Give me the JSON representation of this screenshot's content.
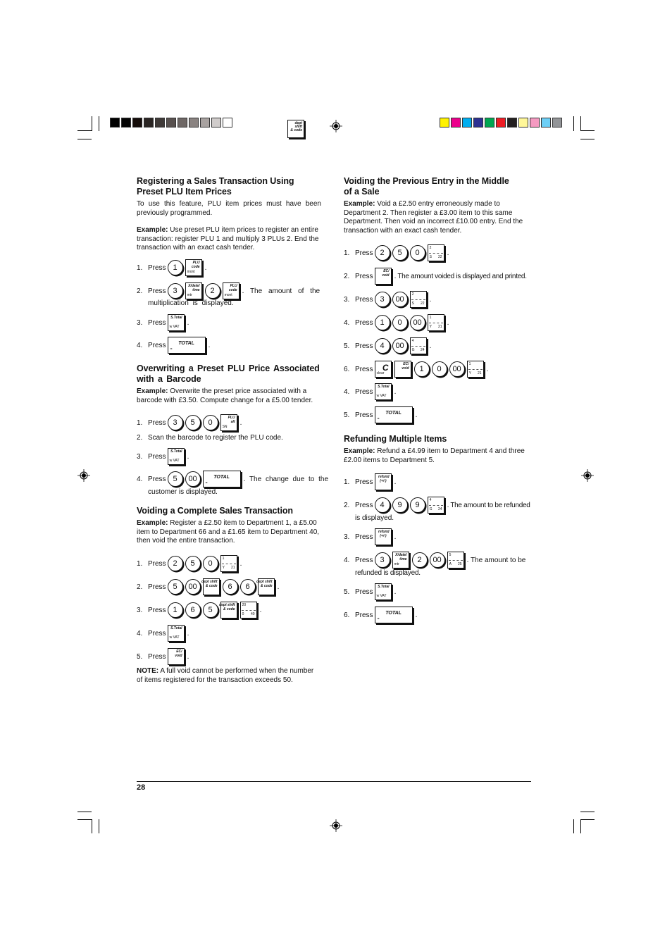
{
  "print_marks": {
    "gray_swatches": [
      "#000000",
      "#050505",
      "#150d0a",
      "#2a2523",
      "#3f3a38",
      "#58514f",
      "#6e6765",
      "#8a8381",
      "#a8a2a0",
      "#d0cccb",
      "#ffffff"
    ],
    "color_swatches": [
      "#fff200",
      "#ec008c",
      "#00aeef",
      "#2e3192",
      "#00a651",
      "#ed1c24",
      "#231f20",
      "#fff799",
      "#f49ac1",
      "#6dcff6",
      "#939598"
    ],
    "header_key": {
      "line1": "dept shift",
      "line2": "& code"
    }
  },
  "left": {
    "section1": {
      "title": "Registering a Sales Transaction Using Preset PLU Item Prices",
      "intro": "To use this feature, PLU item prices must have been previously programmed.",
      "example_label": "Example:",
      "example_text": " Use preset PLU item prices to register an entire transaction: register PLU 1 and multiply 3 PLUs 2. End the transaction with an exact cash tender.",
      "steps": [
        {
          "num": "1.",
          "press": "Press",
          "keys": [
            "1"
          ],
          "key_plu": "PLU",
          "key_code": "code",
          "key_mont": "mont",
          "trail": "."
        },
        {
          "num": "2.",
          "press": "Press",
          "keys": [
            "3",
            "2"
          ],
          "key_x": "X/date/",
          "key_time": "time",
          "key_mtr": "mtr",
          "trail": ". The amount of the",
          "cont": "multiplication is displayed."
        },
        {
          "num": "3.",
          "press": "Press",
          "key_stotal": "S.Total",
          "key_vat": "w  VAT",
          "trail": "."
        },
        {
          "num": "4.",
          "press": "Press",
          "key_total": "TOTAL",
          "key_eq": "=",
          "trail": "."
        }
      ]
    },
    "section2": {
      "title": "Overwriting a Preset PLU Price Associated with a Barcode",
      "example_label": "Example:",
      "example_text": " Overwrite the preset price associated with a barcode with £3.50. Compute change for a £5.00 tender.",
      "steps": [
        {
          "num": "1.",
          "press": "Press",
          "keys": [
            "3",
            "5",
            "0"
          ],
          "key_plu": "PLU",
          "key_alt": "alt",
          "key_sn": "SN",
          "trail": "."
        },
        {
          "num": "2.",
          "text": "Scan the barcode to register the PLU code."
        },
        {
          "num": "3.",
          "press": "Press",
          "trail": "."
        },
        {
          "num": "4.",
          "press": "Press",
          "keys": [
            "5",
            "00"
          ],
          "trail": ". The change due to the",
          "cont": "customer is displayed."
        }
      ]
    },
    "section3": {
      "title": "Voiding a Complete Sales Transaction",
      "example_label": "Example:",
      "example_text": " Register a £2.50 item to Department 1, a £5.00 item to Department 66 and a £1.65 item to Department 40, then void the entire transaction.",
      "steps": [
        {
          "num": "1.",
          "press": "Press",
          "keys": [
            "2",
            "5",
            "0"
          ],
          "disp": {
            "tl": "1",
            "bl": "Y",
            "br": "21"
          },
          "trail": "."
        },
        {
          "num": "2.",
          "press": "Press",
          "keys": [
            "5",
            "00",
            "6",
            "6"
          ],
          "trail": "."
        },
        {
          "num": "3.",
          "press": "Press",
          "keys": [
            "1",
            "6",
            "5"
          ],
          "disp": {
            "tl": "20",
            "bl": "0",
            "br": "40"
          },
          "trail": "."
        },
        {
          "num": "4.",
          "press": "Press",
          "trail": "."
        },
        {
          "num": "5.",
          "press": "Press",
          "key_ec": "EC/",
          "key_void": "void",
          "trail": "."
        }
      ],
      "note_label": "NOTE:",
      "note_text": " A full void cannot be performed when the number of items registered for the transaction exceeds 50."
    }
  },
  "right": {
    "section4": {
      "title": "Voiding the Previous Entry in the Middle of a Sale",
      "example_label": "Example:",
      "example_text": " Void a £2.50 entry erroneously made to Department 2. Then register a £3.00 item to this same Department. Then void an incorrect £10.00 entry. End the transaction with an exact cash tender.",
      "steps": [
        {
          "num": "1.",
          "press": "Press",
          "keys": [
            "2",
            "5",
            "0"
          ],
          "disp": {
            "tl": "2",
            "bl": "S",
            "br": "22"
          },
          "trail": "."
        },
        {
          "num": "2.",
          "press": "Press",
          "trail": ". The amount voided is displayed and printed."
        },
        {
          "num": "3.",
          "press": "Press",
          "keys": [
            "3",
            "00"
          ],
          "disp": {
            "tl": "2",
            "bl": "S",
            "br": "22"
          },
          "trail": "."
        },
        {
          "num": "4.",
          "press": "Press",
          "keys": [
            "1",
            "0",
            "00"
          ],
          "disp": {
            "tl": "1",
            "bl": "Y",
            "br": "21"
          },
          "trail": "."
        },
        {
          "num": "5.",
          "press": "Press",
          "keys": [
            "4",
            "00"
          ],
          "disp": {
            "tl": "4",
            "bl": "G",
            "br": "24"
          },
          "trail": "."
        },
        {
          "num": "6.",
          "press": "Press",
          "key_c": "C",
          "key_clear": "clear",
          "keys": [
            "1",
            "0",
            "00"
          ],
          "disp": {
            "tl": "1",
            "bl": "Y",
            "br": "21"
          },
          "trail": "."
        },
        {
          "num": "4.",
          "press": "Press",
          "trail": "."
        },
        {
          "num": "5.",
          "press": "Press",
          "trail": "."
        }
      ]
    },
    "section5": {
      "title": "Refunding Multiple Items",
      "example_label": "Example:",
      "example_text": " Refund a £4.99 item to Department 4 and three £2.00 items to Department 5.",
      "steps": [
        {
          "num": "1.",
          "press": "Press",
          "key_refund": "refund",
          "key_pm": "(+/-)",
          "trail": "."
        },
        {
          "num": "2.",
          "press": "Press",
          "keys": [
            "4",
            "9",
            "9"
          ],
          "disp": {
            "tl": "4",
            "bl": "G",
            "br": "24"
          },
          "trail": ". The amount to be refunded",
          "cont": "is displayed."
        },
        {
          "num": "3.",
          "press": "Press",
          "trail": "."
        },
        {
          "num": "4.",
          "press": "Press",
          "keys": [
            "3",
            "2",
            "00"
          ],
          "disp": {
            "tl": "5",
            "bl": "A",
            "br": "25"
          },
          "trail": ". The amount to be",
          "cont": "refunded is displayed."
        },
        {
          "num": "5.",
          "press": "Press",
          "trail": "."
        },
        {
          "num": "6.",
          "press": "Press",
          "trail": "."
        }
      ]
    }
  },
  "footer": {
    "page_number": "28"
  }
}
